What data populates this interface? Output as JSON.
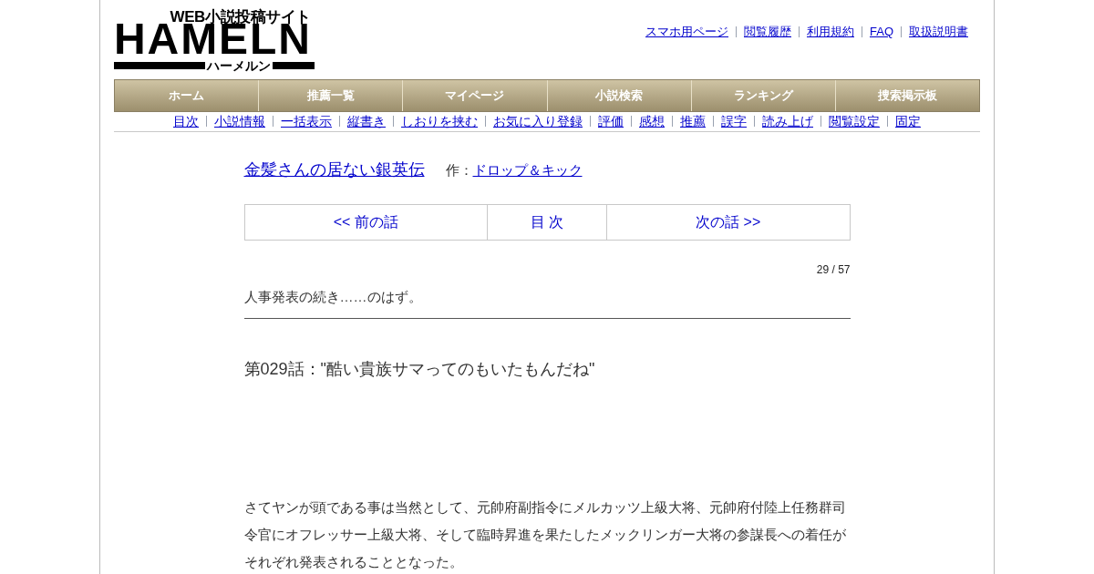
{
  "logo": {
    "tagline": "WEB小説投稿サイト",
    "wordmark": "HAMELN",
    "kana": "ハーメルン"
  },
  "header_links": [
    "スマホ用ページ",
    "閲覧履歴",
    "利用規約",
    "FAQ",
    "取扱説明書"
  ],
  "nav": [
    "ホーム",
    "推薦一覧",
    "マイページ",
    "小説検索",
    "ランキング",
    "捜索掲示板"
  ],
  "chapter_links": [
    "目次",
    "小説情報",
    "一括表示",
    "縦書き",
    "しおりを挟む",
    "お気に入り登録",
    "評価",
    "感想",
    "推薦",
    "誤字",
    "読み上げ",
    "閲覧設定",
    "固定"
  ],
  "novel": {
    "title": "金髪さんの居ない銀英伝",
    "author_label": "作：",
    "author": "ドロップ＆キック"
  },
  "pager": [
    "<< 前の話",
    "目 次",
    "次の話 >>"
  ],
  "counter": "29 / 57",
  "preface": "人事発表の続き……のはず。",
  "chapter_title": "第029話：\"酷い貴族サマってのもいたもんだね\"",
  "body": [
    "さてヤンが頭である事は当然として、元帥府副指令にメルカッツ上級大将、元帥府付陸上任務群司令官にオフレッサー上級大将、そして臨時昇進を果たしたメックリンガー大将の参謀長への着任がそれぞれ発表されることとなった。"
  ]
}
